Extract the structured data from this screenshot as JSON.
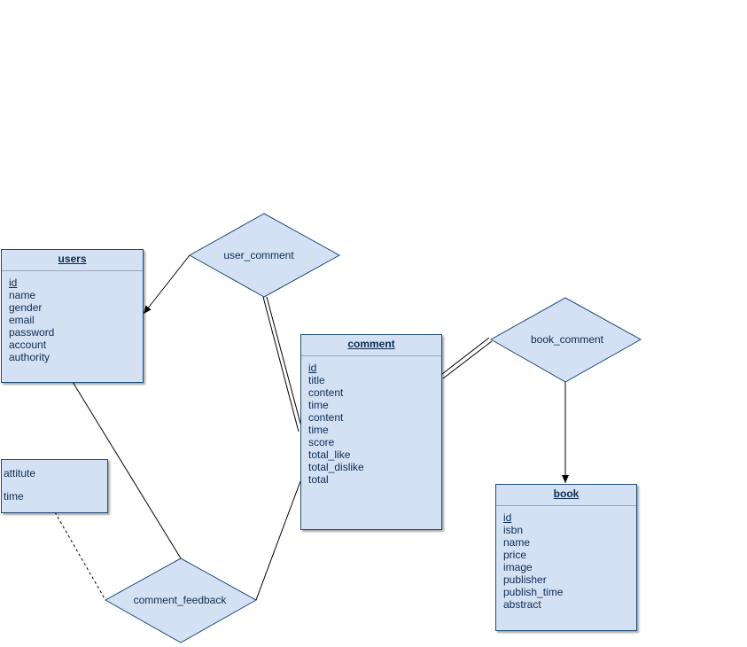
{
  "entities": {
    "users": {
      "title": "users",
      "attributes": [
        "id",
        "name",
        "gender",
        "email",
        "password",
        "account",
        "authority"
      ]
    },
    "comment": {
      "title": "comment",
      "attributes": [
        "id",
        "title",
        "content",
        "time",
        "content",
        "time",
        "score",
        "total_like",
        "total_dislike",
        "total"
      ]
    },
    "book": {
      "title": "book",
      "attributes": [
        "id",
        "isbn",
        "name",
        "price",
        "image",
        "publisher",
        "publish_time",
        "abstract"
      ]
    }
  },
  "relationship_attributes": [
    "attitute",
    "time"
  ],
  "relationships": {
    "user_comment": "user_comment",
    "book_comment": "book_comment",
    "comment_feedback": "comment_feedback"
  },
  "colors": {
    "fill": "#d4e1f5",
    "stroke": "#1f4e79",
    "text": "#0e2a4f"
  }
}
